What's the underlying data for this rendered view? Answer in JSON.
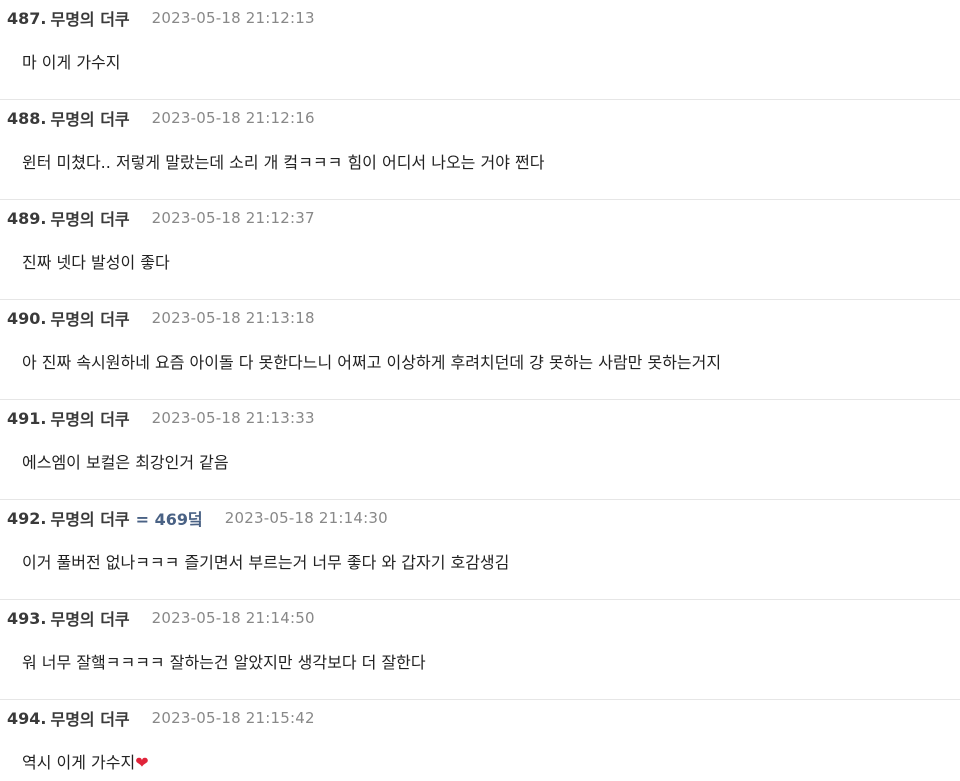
{
  "posts": [
    {
      "num": "487.",
      "author": "무명의 더쿠",
      "tag": "",
      "timestamp": "2023-05-18 21:12:13",
      "body": "마 이게 가수지",
      "emoji": ""
    },
    {
      "num": "488.",
      "author": "무명의 더쿠",
      "tag": "",
      "timestamp": "2023-05-18 21:12:16",
      "body": "윈터 미쳤다.. 저렇게 말랐는데 소리 개 컼ㅋㅋㅋ 힘이 어디서 나오는 거야 쩐다",
      "emoji": ""
    },
    {
      "num": "489.",
      "author": "무명의 더쿠",
      "tag": "",
      "timestamp": "2023-05-18 21:12:37",
      "body": "진짜 넷다 발성이 좋다",
      "emoji": ""
    },
    {
      "num": "490.",
      "author": "무명의 더쿠",
      "tag": "",
      "timestamp": "2023-05-18 21:13:18",
      "body": "아 진짜 속시원하네 요즘 아이돌 다 못한다느니 어쩌고 이상하게 후려치던데 걍 못하는 사람만 못하는거지",
      "emoji": ""
    },
    {
      "num": "491.",
      "author": "무명의 더쿠",
      "tag": "",
      "timestamp": "2023-05-18 21:13:33",
      "body": "에스엠이 보컬은 최강인거 같음",
      "emoji": ""
    },
    {
      "num": "492.",
      "author": "무명의 더쿠",
      "tag": "= 469덬",
      "timestamp": "2023-05-18 21:14:30",
      "body": "이거 풀버전 없나ㅋㅋㅋ 즐기면서 부르는거 너무 좋다 와 갑자기 호감생김",
      "emoji": ""
    },
    {
      "num": "493.",
      "author": "무명의 더쿠",
      "tag": "",
      "timestamp": "2023-05-18 21:14:50",
      "body": "워 너무 잘햌ㅋㅋㅋㅋ 잘하는건 알았지만 생각보다 더 잘한다",
      "emoji": ""
    },
    {
      "num": "494.",
      "author": "무명의 더쿠",
      "tag": "",
      "timestamp": "2023-05-18 21:15:42",
      "body": "역시 이게 가수지",
      "emoji": "❤"
    }
  ]
}
